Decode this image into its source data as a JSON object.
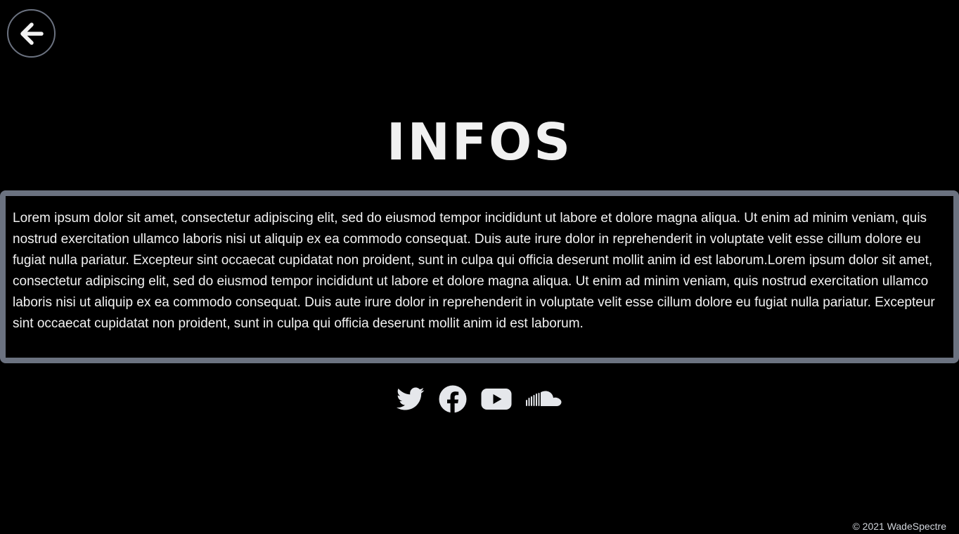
{
  "page": {
    "title": "INFOS"
  },
  "navigation": {
    "back_icon": "arrow-left-icon"
  },
  "info": {
    "text": "Lorem ipsum dolor sit amet, consectetur adipiscing elit, sed do eiusmod tempor incididunt ut labore et dolore magna aliqua. Ut enim ad minim veniam, quis nostrud exercitation ullamco laboris nisi ut aliquip ex ea commodo consequat. Duis aute irure dolor in reprehenderit in voluptate velit esse cillum dolore eu fugiat nulla pariatur. Excepteur sint occaecat cupidatat non proident, sunt in culpa qui officia deserunt mollit anim id est laborum.Lorem ipsum dolor sit amet, consectetur adipiscing elit, sed do eiusmod tempor incididunt ut labore et dolore magna aliqua. Ut enim ad minim veniam, quis nostrud exercitation ullamco laboris nisi ut aliquip ex ea commodo consequat. Duis aute irure dolor in reprehenderit in voluptate velit esse cillum dolore eu fugiat nulla pariatur. Excepteur sint occaecat cupidatat non proident, sunt in culpa qui officia deserunt mollit anim id est laborum."
  },
  "socials": [
    {
      "icon": "twitter-icon"
    },
    {
      "icon": "facebook-icon"
    },
    {
      "icon": "youtube-icon"
    },
    {
      "icon": "soundcloud-icon"
    }
  ],
  "footer": {
    "copyright": "© 2021 WadeSpectre"
  },
  "colors": {
    "background": "#000000",
    "border": "#6b7280",
    "text": "#f2f2f2",
    "icon": "#e5e7eb"
  }
}
